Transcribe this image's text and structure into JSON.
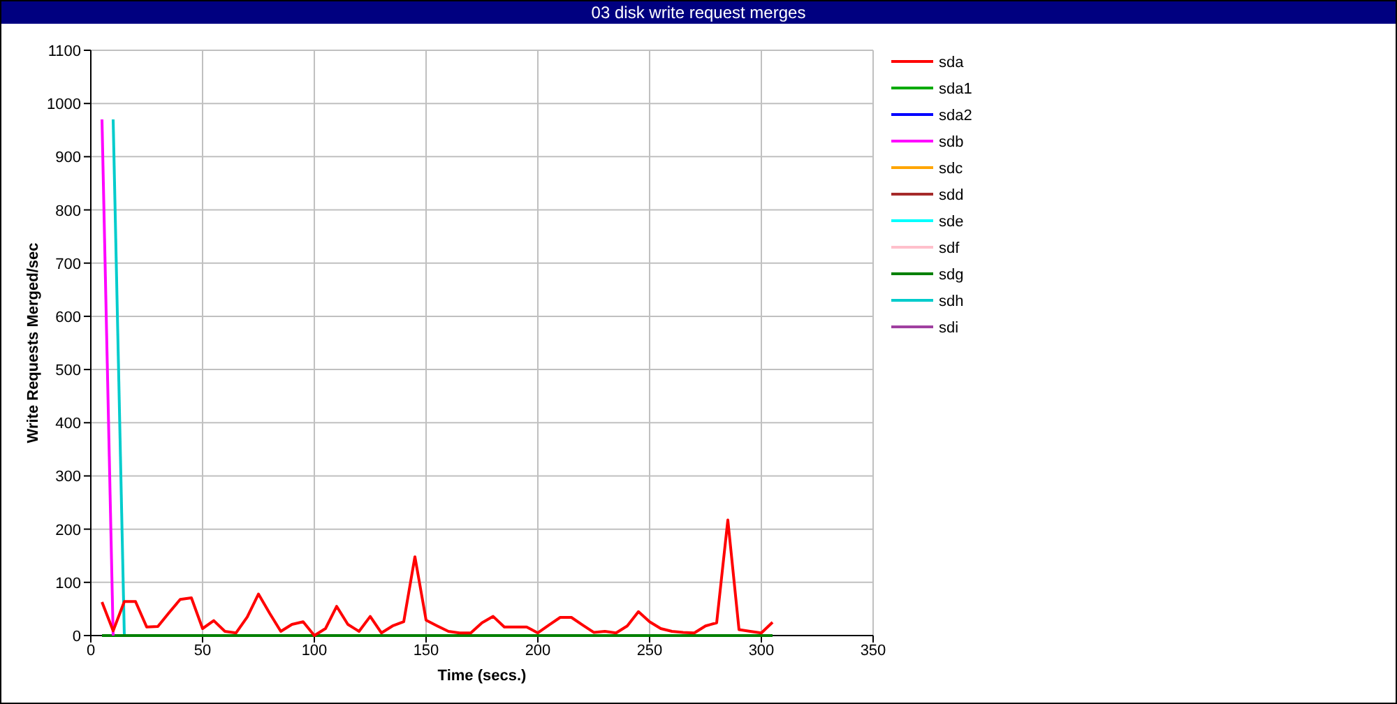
{
  "title": "03 disk write request merges",
  "chart_data": {
    "type": "line",
    "xlabel": "Time (secs.)",
    "ylabel": "Write Requests Merged/sec",
    "xlim": [
      0,
      350
    ],
    "ylim": [
      0,
      1100
    ],
    "grid": true,
    "legend": true,
    "xticks": [
      0,
      50,
      100,
      150,
      200,
      250,
      300,
      350
    ],
    "yticks": [
      0,
      100,
      200,
      300,
      400,
      500,
      600,
      700,
      800,
      900,
      1000,
      1100
    ],
    "x": [
      5,
      10,
      15,
      20,
      25,
      30,
      35,
      40,
      45,
      50,
      55,
      60,
      65,
      70,
      75,
      80,
      85,
      90,
      95,
      100,
      105,
      110,
      115,
      120,
      125,
      130,
      135,
      140,
      145,
      150,
      155,
      160,
      165,
      170,
      175,
      180,
      185,
      190,
      195,
      200,
      205,
      210,
      215,
      220,
      225,
      230,
      235,
      240,
      245,
      250,
      255,
      260,
      265,
      270,
      275,
      280,
      285,
      290,
      295,
      300,
      305
    ],
    "series": [
      {
        "name": "sda",
        "color": "#ff0000",
        "values": [
          63,
          9,
          64,
          64,
          16,
          17,
          43,
          68,
          71,
          13,
          28,
          8,
          5,
          35,
          78,
          42,
          8,
          21,
          26,
          0,
          13,
          55,
          21,
          8,
          36,
          5,
          18,
          26,
          148,
          29,
          18,
          8,
          5,
          5,
          24,
          36,
          16,
          16,
          16,
          5,
          20,
          34,
          34,
          20,
          6,
          8,
          5,
          18,
          45,
          26,
          13,
          8,
          6,
          5,
          18,
          24,
          217,
          11,
          8,
          5,
          25
        ]
      },
      {
        "name": "sda1",
        "color": "#00aa00",
        "values": [
          null,
          null,
          null,
          null,
          null,
          null,
          null,
          null,
          null,
          null,
          null,
          null,
          null,
          null,
          null,
          null,
          null,
          null,
          null,
          null,
          null,
          null,
          null,
          null,
          null,
          null,
          null,
          null,
          null,
          null,
          null,
          null,
          null,
          null,
          null,
          null,
          null,
          null,
          null,
          null,
          null,
          null,
          null,
          null,
          null,
          null,
          null,
          null,
          null,
          null,
          null,
          null,
          null,
          null,
          null,
          null,
          null,
          null,
          null,
          null,
          null
        ]
      },
      {
        "name": "sda2",
        "color": "#0000ff",
        "values": [
          null,
          null,
          null,
          null,
          null,
          null,
          null,
          null,
          null,
          null,
          null,
          null,
          null,
          null,
          null,
          null,
          null,
          null,
          null,
          null,
          null,
          null,
          null,
          null,
          null,
          null,
          null,
          null,
          null,
          null,
          null,
          null,
          null,
          null,
          null,
          null,
          null,
          null,
          null,
          null,
          null,
          null,
          null,
          null,
          null,
          null,
          null,
          null,
          null,
          null,
          null,
          null,
          null,
          null,
          null,
          null,
          null,
          null,
          null,
          null,
          null
        ]
      },
      {
        "name": "sdb",
        "color": "#ff00ff",
        "values": [
          970,
          0,
          null,
          null,
          null,
          null,
          null,
          null,
          null,
          null,
          null,
          null,
          null,
          null,
          null,
          null,
          null,
          null,
          null,
          null,
          null,
          null,
          null,
          null,
          null,
          null,
          null,
          null,
          null,
          null,
          null,
          null,
          null,
          null,
          null,
          null,
          null,
          null,
          null,
          null,
          null,
          null,
          null,
          null,
          null,
          null,
          null,
          null,
          null,
          null,
          null,
          null,
          null,
          null,
          null,
          null,
          null,
          null,
          null,
          null,
          null
        ]
      },
      {
        "name": "sdc",
        "color": "#ffa500",
        "values": [
          null,
          null,
          null,
          null,
          null,
          null,
          null,
          null,
          null,
          null,
          null,
          null,
          null,
          null,
          null,
          null,
          null,
          null,
          null,
          null,
          null,
          null,
          null,
          null,
          null,
          null,
          null,
          null,
          null,
          null,
          null,
          null,
          null,
          null,
          null,
          null,
          null,
          null,
          null,
          null,
          null,
          null,
          null,
          null,
          null,
          null,
          null,
          null,
          null,
          null,
          null,
          null,
          null,
          null,
          null,
          null,
          null,
          null,
          null,
          null,
          null
        ]
      },
      {
        "name": "sdd",
        "color": "#a52a2a",
        "values": [
          null,
          null,
          null,
          null,
          null,
          null,
          null,
          null,
          null,
          null,
          null,
          null,
          null,
          null,
          null,
          null,
          null,
          null,
          null,
          null,
          null,
          null,
          null,
          null,
          null,
          null,
          null,
          null,
          null,
          null,
          null,
          null,
          null,
          null,
          null,
          null,
          null,
          null,
          null,
          null,
          null,
          null,
          null,
          null,
          null,
          null,
          null,
          null,
          null,
          null,
          null,
          null,
          null,
          null,
          null,
          null,
          null,
          null,
          null,
          null,
          null
        ]
      },
      {
        "name": "sde",
        "color": "#00ffff",
        "values": [
          null,
          null,
          null,
          null,
          null,
          null,
          null,
          null,
          null,
          null,
          null,
          null,
          null,
          null,
          null,
          null,
          null,
          null,
          null,
          null,
          null,
          null,
          null,
          null,
          null,
          null,
          null,
          null,
          null,
          null,
          null,
          null,
          null,
          null,
          null,
          null,
          null,
          null,
          null,
          null,
          null,
          null,
          null,
          null,
          null,
          null,
          null,
          null,
          null,
          null,
          null,
          null,
          null,
          null,
          null,
          null,
          null,
          null,
          null,
          null,
          null
        ]
      },
      {
        "name": "sdf",
        "color": "#ffc0cb",
        "values": [
          null,
          null,
          null,
          null,
          null,
          null,
          null,
          null,
          null,
          null,
          null,
          null,
          null,
          null,
          null,
          null,
          null,
          null,
          null,
          null,
          null,
          null,
          null,
          null,
          null,
          null,
          null,
          null,
          null,
          null,
          null,
          null,
          null,
          null,
          null,
          null,
          null,
          null,
          null,
          null,
          null,
          null,
          null,
          null,
          null,
          null,
          null,
          null,
          null,
          null,
          null,
          null,
          null,
          null,
          null,
          null,
          null,
          null,
          null,
          null,
          null
        ]
      },
      {
        "name": "sdg",
        "color": "#008000",
        "values": [
          0,
          0,
          0,
          0,
          0,
          0,
          0,
          0,
          0,
          0,
          0,
          0,
          0,
          0,
          0,
          0,
          0,
          0,
          0,
          0,
          0,
          0,
          0,
          0,
          0,
          0,
          0,
          0,
          0,
          0,
          0,
          0,
          0,
          0,
          0,
          0,
          0,
          0,
          0,
          0,
          0,
          0,
          0,
          0,
          0,
          0,
          0,
          0,
          0,
          0,
          0,
          0,
          0,
          0,
          0,
          0,
          0,
          0,
          0,
          0,
          0
        ]
      },
      {
        "name": "sdh",
        "color": "#00cccc",
        "values": [
          null,
          970,
          0,
          null,
          null,
          null,
          null,
          null,
          null,
          null,
          null,
          null,
          null,
          null,
          null,
          null,
          null,
          null,
          null,
          null,
          null,
          null,
          null,
          null,
          null,
          null,
          null,
          null,
          null,
          null,
          null,
          null,
          null,
          null,
          null,
          null,
          null,
          null,
          null,
          null,
          null,
          null,
          null,
          null,
          null,
          null,
          null,
          null,
          null,
          null,
          null,
          null,
          null,
          null,
          null,
          null,
          null,
          null,
          null,
          null,
          null
        ]
      },
      {
        "name": "sdi",
        "color": "#a040a0",
        "values": [
          null,
          null,
          null,
          null,
          null,
          null,
          null,
          null,
          null,
          null,
          null,
          null,
          null,
          null,
          null,
          null,
          null,
          null,
          null,
          null,
          null,
          null,
          null,
          null,
          null,
          null,
          null,
          null,
          null,
          null,
          null,
          null,
          null,
          null,
          null,
          null,
          null,
          null,
          null,
          null,
          null,
          null,
          null,
          null,
          null,
          null,
          null,
          null,
          null,
          null,
          null,
          null,
          null,
          null,
          null,
          null,
          null,
          null,
          null,
          null,
          null
        ]
      }
    ]
  }
}
